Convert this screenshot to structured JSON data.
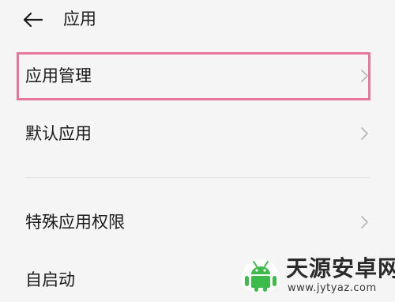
{
  "header": {
    "title": "应用",
    "back_icon": "arrow-left-icon"
  },
  "list": {
    "items": [
      {
        "label": "应用管理",
        "icon": "chevron-right-icon",
        "highlighted": true
      },
      {
        "label": "默认应用",
        "icon": "chevron-right-icon",
        "highlighted": false
      },
      {
        "label": "特殊应用权限",
        "icon": "chevron-right-icon",
        "highlighted": false
      },
      {
        "label": "自启动",
        "icon": "chevron-right-icon",
        "highlighted": false
      }
    ]
  },
  "watermark": {
    "name": "天源安卓网",
    "url": "www.jytyaz.com",
    "logo_icon": "android-logo-icon"
  },
  "colors": {
    "background": "#f5f5f5",
    "text": "#1a1a1a",
    "highlight_border": "#e8769a",
    "chevron": "#b5b5b5",
    "divider": "#e4e4e4",
    "logo_green": "#3dbb4a"
  }
}
